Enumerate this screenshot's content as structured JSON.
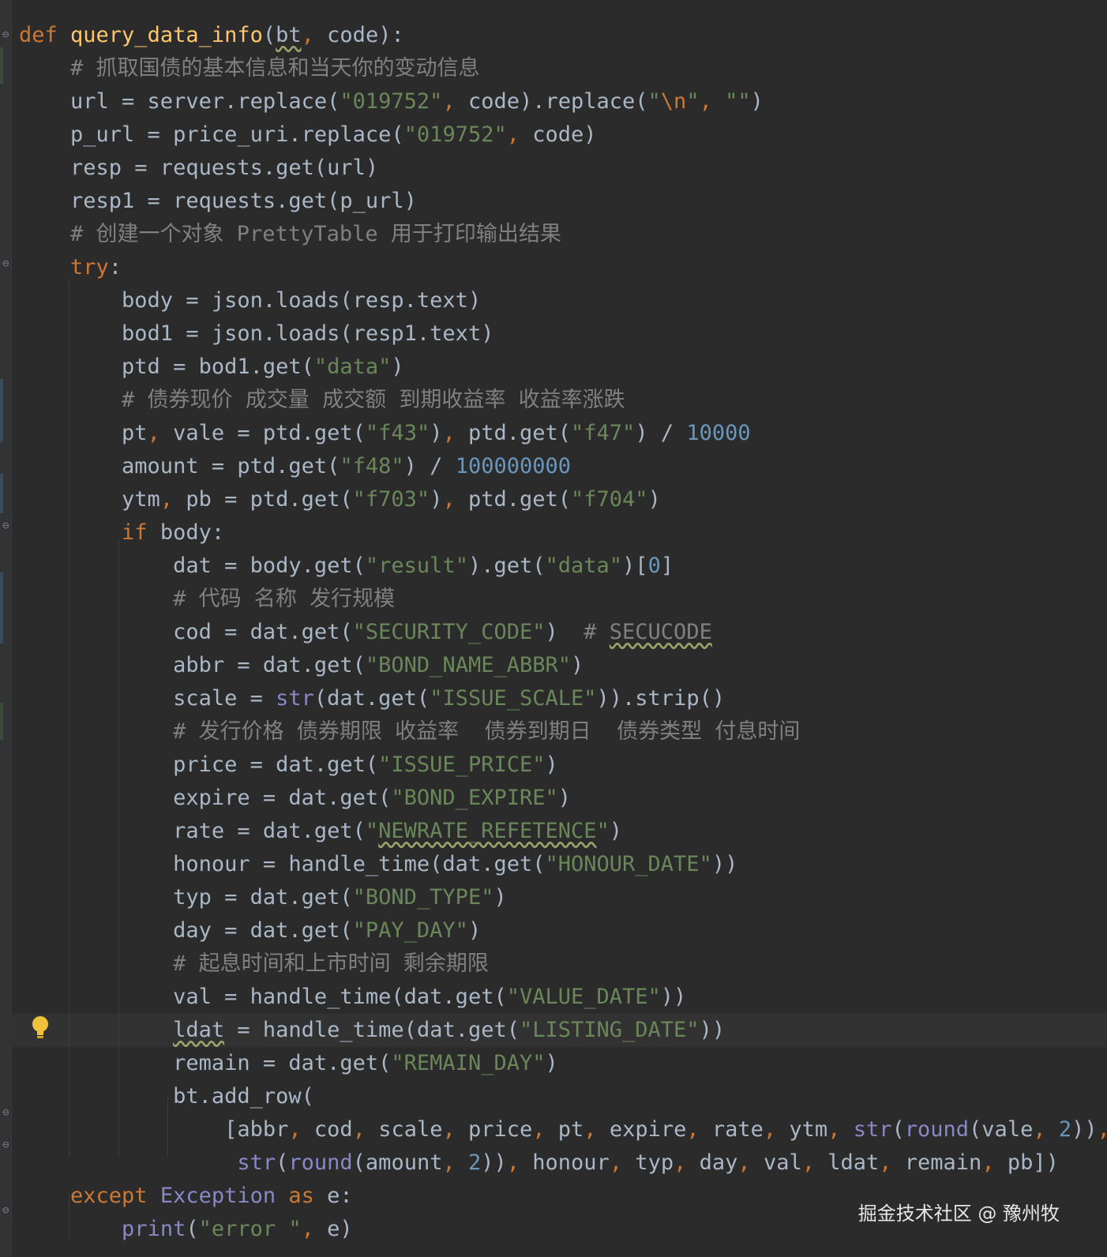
{
  "editor": {
    "language": "python",
    "theme_colors": {
      "background": "#2b2b2b",
      "keyword": "#cc7832",
      "function_name": "#ffc66d",
      "comment": "#808080",
      "string": "#6a8759",
      "number": "#6897bb",
      "builtin": "#8888c6",
      "text": "#a9b7c6"
    },
    "lines": [
      [
        [
          "kw",
          "def "
        ],
        [
          "fn",
          "query_data_info"
        ],
        [
          "pl",
          "("
        ],
        [
          "sq",
          "bt"
        ],
        [
          "kw",
          ", "
        ],
        [
          "pl",
          "code):"
        ]
      ],
      [
        [
          "pl",
          "    "
        ],
        [
          "cm",
          "# 抓取国债的基本信息和当天你的变动信息"
        ]
      ],
      [
        [
          "pl",
          "    url = server.replace("
        ],
        [
          "str",
          "\"019752\""
        ],
        [
          "kw",
          ", "
        ],
        [
          "pl",
          "code).replace("
        ],
        [
          "str",
          "\""
        ],
        [
          "esc",
          "\\n"
        ],
        [
          "str",
          "\""
        ],
        [
          "kw",
          ", "
        ],
        [
          "str",
          "\"\""
        ],
        [
          "pl",
          ")"
        ]
      ],
      [
        [
          "pl",
          "    p_url = price_uri.replace("
        ],
        [
          "str",
          "\"019752\""
        ],
        [
          "kw",
          ", "
        ],
        [
          "pl",
          "code)"
        ]
      ],
      [
        [
          "pl",
          "    resp = requests.get(url)"
        ]
      ],
      [
        [
          "pl",
          "    resp1 = requests.get(p_url)"
        ]
      ],
      [
        [
          "pl",
          "    "
        ],
        [
          "cm",
          "# 创建一个对象 PrettyTable 用于打印输出结果"
        ]
      ],
      [
        [
          "pl",
          "    "
        ],
        [
          "kw",
          "try"
        ],
        [
          "pl",
          ":"
        ]
      ],
      [
        [
          "pl",
          "        body = json.loads(resp.text)"
        ]
      ],
      [
        [
          "pl",
          "        bod1 = json.loads(resp1.text)"
        ]
      ],
      [
        [
          "pl",
          "        ptd = bod1.get("
        ],
        [
          "str",
          "\"data\""
        ],
        [
          "pl",
          ")"
        ]
      ],
      [
        [
          "pl",
          "        "
        ],
        [
          "cm",
          "# 债券现价 成交量 成交额 到期收益率 收益率涨跌"
        ]
      ],
      [
        [
          "pl",
          "        pt"
        ],
        [
          "kw",
          ", "
        ],
        [
          "pl",
          "vale = ptd.get("
        ],
        [
          "str",
          "\"f43\""
        ],
        [
          "pl",
          ")"
        ],
        [
          "kw",
          ", "
        ],
        [
          "pl",
          "ptd.get("
        ],
        [
          "str",
          "\"f47\""
        ],
        [
          "pl",
          ") / "
        ],
        [
          "num",
          "10000"
        ]
      ],
      [
        [
          "pl",
          "        amount = ptd.get("
        ],
        [
          "str",
          "\"f48\""
        ],
        [
          "pl",
          ") / "
        ],
        [
          "num",
          "100000000"
        ]
      ],
      [
        [
          "pl",
          "        ytm"
        ],
        [
          "kw",
          ", "
        ],
        [
          "pl",
          "pb = ptd.get("
        ],
        [
          "str",
          "\"f703\""
        ],
        [
          "pl",
          ")"
        ],
        [
          "kw",
          ", "
        ],
        [
          "pl",
          "ptd.get("
        ],
        [
          "str",
          "\"f704\""
        ],
        [
          "pl",
          ")"
        ]
      ],
      [
        [
          "pl",
          "        "
        ],
        [
          "kw",
          "if "
        ],
        [
          "pl",
          "body:"
        ]
      ],
      [
        [
          "pl",
          "            dat = body.get("
        ],
        [
          "str",
          "\"result\""
        ],
        [
          "pl",
          ").get("
        ],
        [
          "str",
          "\"data\""
        ],
        [
          "pl",
          ")["
        ],
        [
          "num",
          "0"
        ],
        [
          "pl",
          "]"
        ]
      ],
      [
        [
          "pl",
          "            "
        ],
        [
          "cm",
          "# 代码 名称 发行规模"
        ]
      ],
      [
        [
          "pl",
          "            cod = dat.get("
        ],
        [
          "str",
          "\"SECURITY_CODE\""
        ],
        [
          "pl",
          ")  "
        ],
        [
          "cm",
          "# "
        ],
        [
          "cmsq",
          "SECUCODE"
        ]
      ],
      [
        [
          "pl",
          "            abbr = dat.get("
        ],
        [
          "str",
          "\"BOND_NAME_ABBR\""
        ],
        [
          "pl",
          ")"
        ]
      ],
      [
        [
          "pl",
          "            scale = "
        ],
        [
          "bi",
          "str"
        ],
        [
          "pl",
          "(dat.get("
        ],
        [
          "str",
          "\"ISSUE_SCALE\""
        ],
        [
          "pl",
          ")).strip()"
        ]
      ],
      [
        [
          "pl",
          "            "
        ],
        [
          "cm",
          "# 发行价格 债券期限 收益率  债券到期日  债券类型 付息时间"
        ]
      ],
      [
        [
          "pl",
          "            price = dat.get("
        ],
        [
          "str",
          "\"ISSUE_PRICE\""
        ],
        [
          "pl",
          ")"
        ]
      ],
      [
        [
          "pl",
          "            expire = dat.get("
        ],
        [
          "str",
          "\"BOND_EXPIRE\""
        ],
        [
          "pl",
          ")"
        ]
      ],
      [
        [
          "pl",
          "            rate = dat.get("
        ],
        [
          "str",
          "\""
        ],
        [
          "strsq",
          "NEWRATE_REFETENCE"
        ],
        [
          "str",
          "\""
        ],
        [
          "pl",
          ")"
        ]
      ],
      [
        [
          "pl",
          "            honour = handle_time(dat.get("
        ],
        [
          "str",
          "\"HONOUR_DATE\""
        ],
        [
          "pl",
          "))"
        ]
      ],
      [
        [
          "pl",
          "            typ = dat.get("
        ],
        [
          "str",
          "\"BOND_TYPE\""
        ],
        [
          "pl",
          ")"
        ]
      ],
      [
        [
          "pl",
          "            day = dat.get("
        ],
        [
          "str",
          "\"PAY_DAY\""
        ],
        [
          "pl",
          ")"
        ]
      ],
      [
        [
          "pl",
          "            "
        ],
        [
          "cm",
          "# 起息时间和上市时间 剩余期限"
        ]
      ],
      [
        [
          "pl",
          "            val = handle_time(dat.get("
        ],
        [
          "str",
          "\"VALUE_DATE\""
        ],
        [
          "pl",
          "))"
        ]
      ],
      [
        [
          "pl",
          "            "
        ],
        [
          "sq",
          "ldat"
        ],
        [
          "pl",
          " = handle_time(dat.get("
        ],
        [
          "str",
          "\"LISTING_DATE\""
        ],
        [
          "pl",
          "))"
        ]
      ],
      [
        [
          "pl",
          "            remain = dat.get("
        ],
        [
          "str",
          "\"REMAIN_DAY\""
        ],
        [
          "pl",
          ")"
        ]
      ],
      [
        [
          "pl",
          "            bt.add_row("
        ]
      ],
      [
        [
          "pl",
          "                [abbr"
        ],
        [
          "kw",
          ", "
        ],
        [
          "pl",
          "cod"
        ],
        [
          "kw",
          ", "
        ],
        [
          "pl",
          "scale"
        ],
        [
          "kw",
          ", "
        ],
        [
          "pl",
          "price"
        ],
        [
          "kw",
          ", "
        ],
        [
          "pl",
          "pt"
        ],
        [
          "kw",
          ", "
        ],
        [
          "pl",
          "expire"
        ],
        [
          "kw",
          ", "
        ],
        [
          "pl",
          "rate"
        ],
        [
          "kw",
          ", "
        ],
        [
          "pl",
          "ytm"
        ],
        [
          "kw",
          ", "
        ],
        [
          "bi",
          "str"
        ],
        [
          "pl",
          "("
        ],
        [
          "bi",
          "round"
        ],
        [
          "pl",
          "(vale"
        ],
        [
          "kw",
          ", "
        ],
        [
          "num",
          "2"
        ],
        [
          "pl",
          "))"
        ],
        [
          "kw",
          ","
        ]
      ],
      [
        [
          "pl",
          "                 "
        ],
        [
          "bi",
          "str"
        ],
        [
          "pl",
          "("
        ],
        [
          "bi",
          "round"
        ],
        [
          "pl",
          "(amount"
        ],
        [
          "kw",
          ", "
        ],
        [
          "num",
          "2"
        ],
        [
          "pl",
          "))"
        ],
        [
          "kw",
          ", "
        ],
        [
          "pl",
          "honour"
        ],
        [
          "kw",
          ", "
        ],
        [
          "pl",
          "typ"
        ],
        [
          "kw",
          ", "
        ],
        [
          "pl",
          "day"
        ],
        [
          "kw",
          ", "
        ],
        [
          "pl",
          "val"
        ],
        [
          "kw",
          ", "
        ],
        [
          "pl",
          "ldat"
        ],
        [
          "kw",
          ", "
        ],
        [
          "pl",
          "remain"
        ],
        [
          "kw",
          ", "
        ],
        [
          "pl",
          "pb])"
        ]
      ],
      [
        [
          "pl",
          "    "
        ],
        [
          "kw",
          "except "
        ],
        [
          "bi",
          "Exception "
        ],
        [
          "kw",
          "as "
        ],
        [
          "pl",
          "e:"
        ]
      ],
      [
        [
          "pl",
          "        "
        ],
        [
          "bi",
          "print"
        ],
        [
          "pl",
          "("
        ],
        [
          "str",
          "\"error \""
        ],
        [
          "kw",
          ", "
        ],
        [
          "pl",
          "e)"
        ]
      ]
    ]
  },
  "watermark": {
    "text": "掘金技术社区 @ 豫州牧"
  }
}
